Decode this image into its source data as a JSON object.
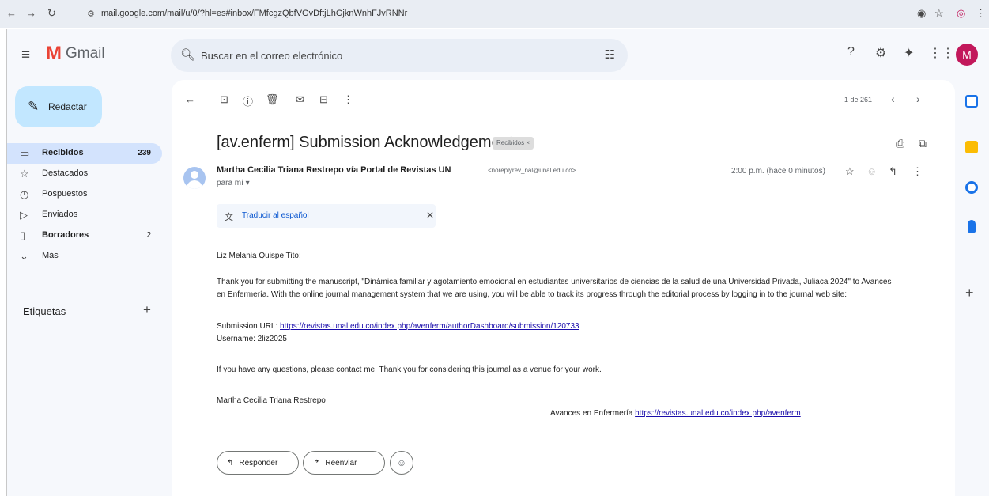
{
  "browser": {
    "url": "mail.google.com/mail/u/0/?hl=es#inbox/FMfcgzQbfVGvDftjLhGjknWnhFJvRNNr"
  },
  "gmail": {
    "app_name": "Gmail",
    "search_placeholder": "Buscar en el correo electrónico",
    "avatar_letter": "M",
    "compose_label": "Redactar",
    "nav": [
      {
        "label": "Recibidos",
        "count": "239",
        "icon": "inbox-icon",
        "active": true
      },
      {
        "label": "Destacados",
        "count": "",
        "icon": "star-icon",
        "active": false
      },
      {
        "label": "Pospuestos",
        "count": "",
        "icon": "clock-icon",
        "active": false
      },
      {
        "label": "Enviados",
        "count": "",
        "icon": "send-icon",
        "active": false
      },
      {
        "label": "Borradores",
        "count": "2",
        "icon": "draft-icon",
        "active": false
      },
      {
        "label": "Más",
        "count": "",
        "icon": "chevron-down-icon",
        "active": false
      }
    ],
    "labels_heading": "Etiquetas",
    "pager": "1 de 261"
  },
  "email": {
    "subject": "[av.enferm] Submission Acknowledgement",
    "label_chip": "Recibidos ×",
    "sender_name": "Martha Cecilia Triana Restrepo vía Portal de Revistas UN",
    "sender_email": "<noreplyrev_nal@unal.edu.co>",
    "to_me": "para mí ▾",
    "time": "2:00 p.m. (hace 0 minutos)",
    "translate_label": "Traducir al español",
    "greeting": "Liz Melania Quispe Tito:",
    "para1_line1": "Thank you for submitting the manuscript, \"Dinámica familiar y agotamiento emocional en estudiantes universitarios de ciencias de la salud de una Universidad Privada, Juliaca 2024\" to Avances",
    "para1_line2": "en Enfermería. With the online journal management system that we are using, you will be able to track its progress through the editorial process by logging in to the journal web site:",
    "submission_label": "Submission URL: ",
    "submission_url": "https://revistas.unal.edu.co/index.php/avenferm/authorDashboard/submission/120733",
    "username_line": "Username: 2liz2025",
    "questions_line": "If you have any questions, please contact me. Thank you for considering this journal as a venue for your work.",
    "signature_name": "Martha Cecilia Triana Restrepo",
    "signature_journal": "Avances en Enfermería ",
    "signature_url": "https://revistas.unal.edu.co/index.php/avenferm",
    "reply_label": "Responder",
    "forward_label": "Reenviar"
  },
  "colors": {
    "accent": "#0b57d0",
    "compose_bg": "#c2e7ff",
    "active_nav_bg": "#d3e3fd",
    "avatar_bg": "#c2185b"
  }
}
